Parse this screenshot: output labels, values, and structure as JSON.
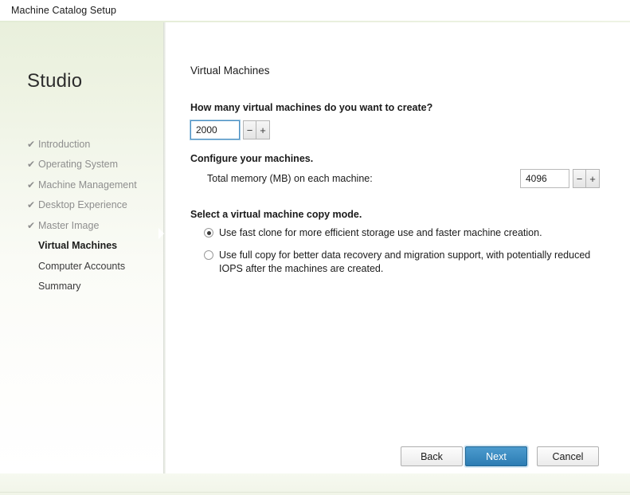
{
  "window": {
    "title": "Machine Catalog Setup"
  },
  "sidebar": {
    "brand": "Studio",
    "items": [
      {
        "label": "Introduction",
        "state": "done",
        "check": "✔"
      },
      {
        "label": "Operating System",
        "state": "done",
        "check": "✔"
      },
      {
        "label": "Machine Management",
        "state": "done",
        "check": "✔"
      },
      {
        "label": "Desktop Experience",
        "state": "done",
        "check": "✔"
      },
      {
        "label": "Master Image",
        "state": "done",
        "check": "✔"
      },
      {
        "label": "Virtual Machines",
        "state": "current",
        "check": ""
      },
      {
        "label": "Computer Accounts",
        "state": "pending",
        "check": ""
      },
      {
        "label": "Summary",
        "state": "pending",
        "check": ""
      }
    ]
  },
  "main": {
    "heading": "Virtual Machines",
    "vm_count": {
      "question": "How many virtual machines do you want to create?",
      "value": "2000",
      "decrement_label": "−",
      "increment_label": "+"
    },
    "configure": {
      "section_label": "Configure your machines.",
      "memory_label": "Total memory (MB) on each machine:",
      "memory_value": "4096",
      "decrement_label": "−",
      "increment_label": "+"
    },
    "copy_mode": {
      "section_label": "Select a virtual machine copy mode.",
      "options": [
        {
          "label": "Use fast clone for more efficient storage use and faster machine creation.",
          "selected": true
        },
        {
          "label": "Use full copy for better data recovery and migration support, with potentially reduced IOPS after the machines are created.",
          "selected": false
        }
      ]
    }
  },
  "footer": {
    "back_label": "Back",
    "next_label": "Next",
    "cancel_label": "Cancel"
  },
  "colors": {
    "primary_button": "#2c7cb3",
    "sidebar_tint": "#e9f0dc",
    "focus_border": "#4a90c4"
  }
}
